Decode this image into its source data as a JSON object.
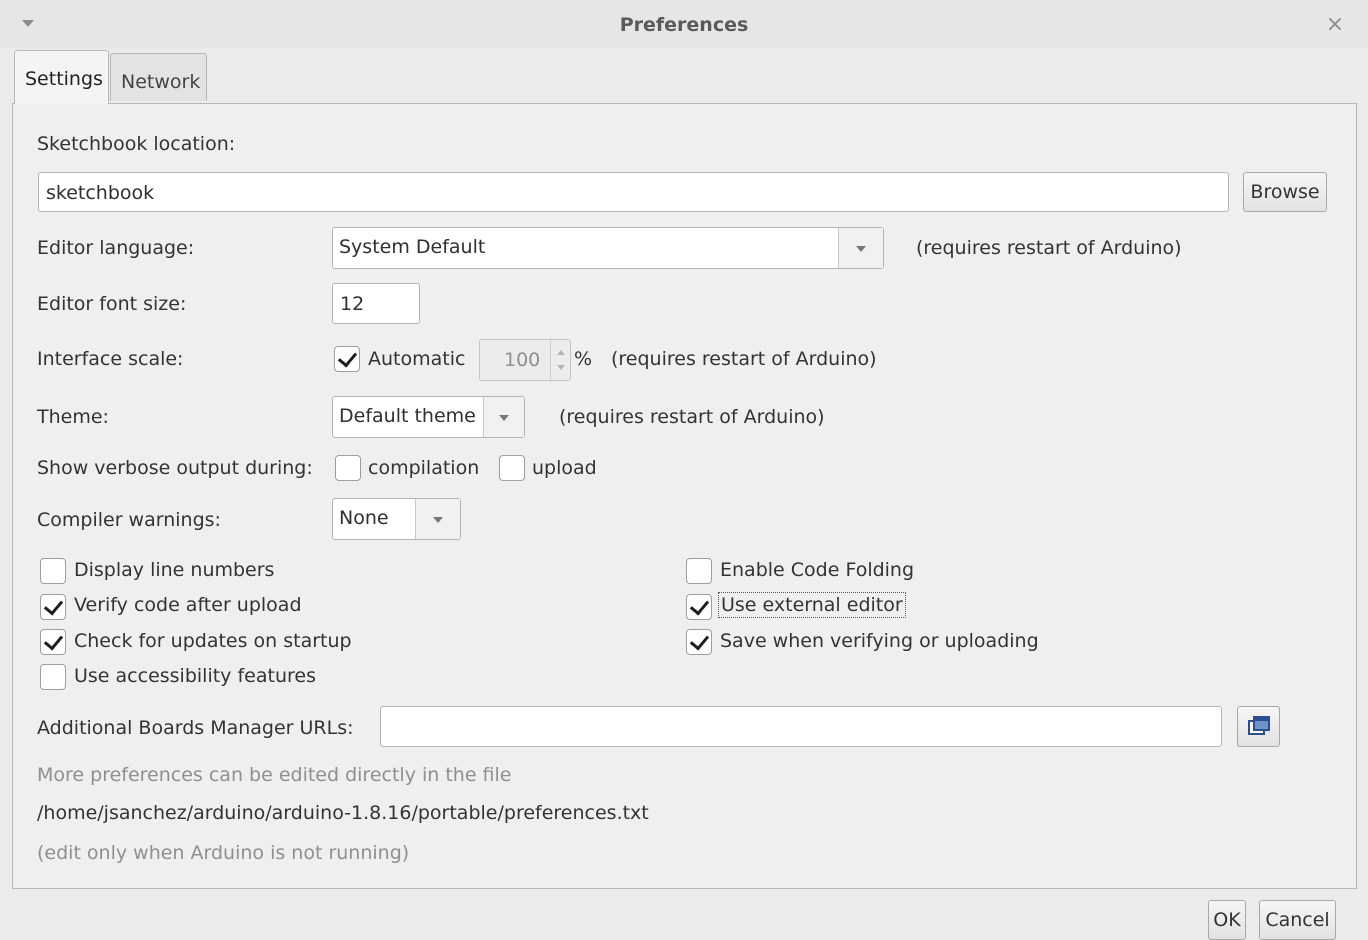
{
  "window": {
    "title": "Preferences",
    "close_glyph": "×"
  },
  "tabs": [
    {
      "label": "Settings"
    },
    {
      "label": "Network"
    }
  ],
  "settings": {
    "sketchbook_label": "Sketchbook location:",
    "sketchbook_value": "sketchbook",
    "browse_label": "Browse",
    "editor_language_label": "Editor language:",
    "editor_language_value": "System Default",
    "restart_note": "(requires restart of Arduino)",
    "font_size_label": "Editor font size:",
    "font_size_value": "12",
    "interface_scale_label": "Interface scale:",
    "automatic_label": "Automatic",
    "scale_value": "100",
    "percent": "%",
    "theme_label": "Theme:",
    "theme_value": "Default theme",
    "verbose_label": "Show verbose output during:",
    "compilation_label": "compilation",
    "upload_label": "upload",
    "warnings_label": "Compiler warnings:",
    "warnings_value": "None",
    "options": [
      {
        "label": "Display line numbers",
        "checked": false
      },
      {
        "label": "Verify code after upload",
        "checked": true
      },
      {
        "label": "Check for updates on startup",
        "checked": true
      },
      {
        "label": "Use accessibility features",
        "checked": false
      },
      {
        "label": "Enable Code Folding",
        "checked": false
      },
      {
        "label": "Use external editor",
        "checked": true
      },
      {
        "label": "Save when verifying or uploading",
        "checked": true
      }
    ],
    "boards_url_label": "Additional Boards Manager URLs:",
    "boards_url_value": "",
    "more_prefs_note": "More preferences can be edited directly in the file",
    "prefs_path": "/home/jsanchez/arduino/arduino-1.8.16/portable/preferences.txt",
    "edit_note": "(edit only when Arduino is not running)"
  },
  "footer": {
    "ok_label": "OK",
    "cancel_label": "Cancel"
  }
}
